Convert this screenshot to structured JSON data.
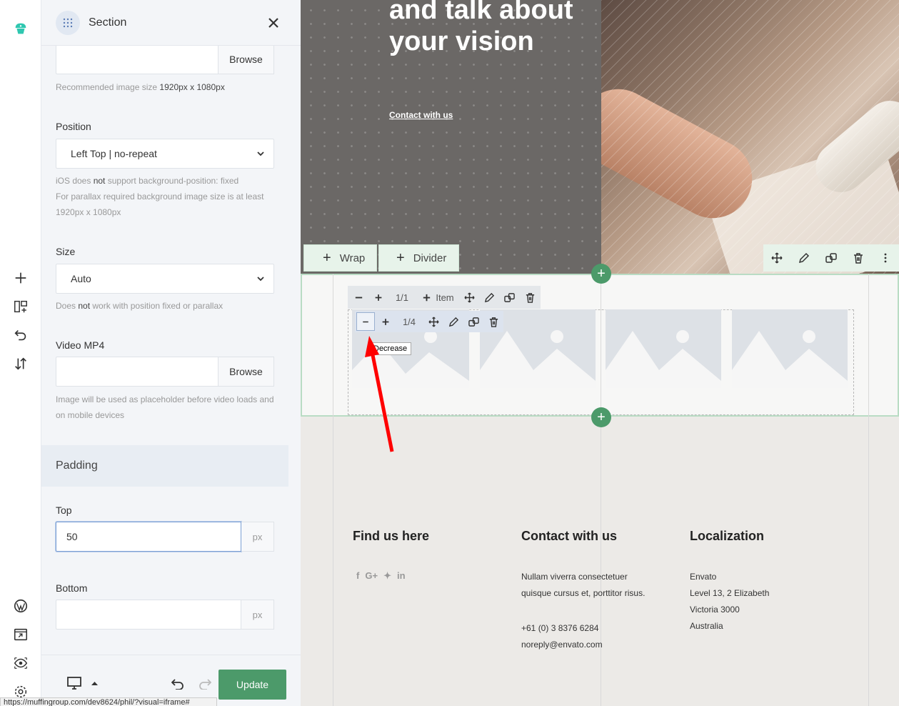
{
  "panel": {
    "title": "Section",
    "browse_label": "Browse",
    "image_hint_prefix": "Recommended image size",
    "image_hint_size": "1920px x 1080px",
    "position_label": "Position",
    "position_value": "Left Top | no-repeat",
    "position_help_1a": "iOS does",
    "position_help_1b": "not",
    "position_help_1c": "support background-position: fixed",
    "position_help_2": "For parallax required background image size is at least 1920px x 1080px",
    "size_label": "Size",
    "size_value": "Auto",
    "size_help_a": "Does",
    "size_help_b": "not",
    "size_help_c": "work with position fixed or parallax",
    "video_label": "Video MP4",
    "video_browse_label": "Browse",
    "video_help": "Image will be used as placeholder before video loads and on mobile devices",
    "padding_heading": "Padding",
    "top_label": "Top",
    "top_value": "50",
    "top_unit": "px",
    "bottom_label": "Bottom",
    "bottom_value": "",
    "bottom_unit": "px",
    "update_label": "Update",
    "status_url": "https://muffingroup.com/dev8624/phil/?visual=iframe#"
  },
  "canvas": {
    "hero_title": "and talk about your vision",
    "hero_link": "Contact with us",
    "wrap_button": "Wrap",
    "divider_button": "Divider",
    "wrap_bar": {
      "size": "1/1",
      "item_label": "Item"
    },
    "item_bar": {
      "size": "1/4"
    },
    "tooltip": "Decrease",
    "footer": {
      "col1_title": "Find us here",
      "col2_title": "Contact with us",
      "col2_line1": "Nullam viverra consectetuer",
      "col2_line2": "quisque cursus et, porttitor risus.",
      "col2_phone": "+61 (0) 3 8376 6284",
      "col2_email": "noreply@envato.com",
      "col3_title": "Localization",
      "col3_line1": "Envato",
      "col3_line2": "Level 13, 2 Elizabeth",
      "col3_line3": "Victoria 3000",
      "col3_line4": "Australia"
    }
  },
  "icons": {
    "social": [
      "facebook-icon",
      "google-plus-icon",
      "twitter-icon",
      "linkedin-icon"
    ]
  },
  "colors": {
    "accent_green": "#4c9a6a",
    "hero_gray": "#6b6866",
    "arrow_red": "#ff0000"
  }
}
